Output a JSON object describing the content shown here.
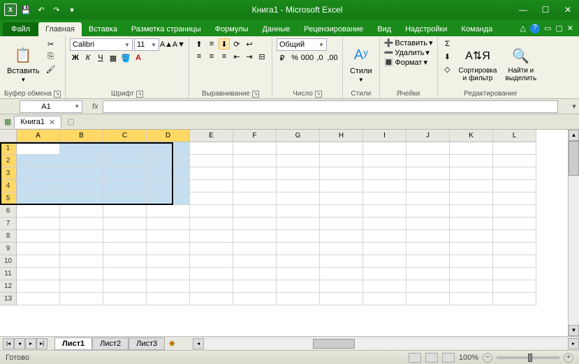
{
  "title": "Книга1 - Microsoft Excel",
  "qat": {
    "save": "💾",
    "undo": "↶",
    "redo": "↷"
  },
  "tabs": {
    "file": "Файл",
    "items": [
      "Главная",
      "Вставка",
      "Разметка страницы",
      "Формулы",
      "Данные",
      "Рецензирование",
      "Вид",
      "Надстройки",
      "Команда"
    ],
    "active": 0
  },
  "ribbon": {
    "clipboard": {
      "label": "Буфер обмена",
      "paste": "Вставить"
    },
    "font": {
      "label": "Шрифт",
      "name": "Calibri",
      "size": "11"
    },
    "align": {
      "label": "Выравнивание"
    },
    "number": {
      "label": "Число",
      "format": "Общий"
    },
    "styles": {
      "label": "Стили",
      "btn": "Стили"
    },
    "cells": {
      "label": "Ячейки",
      "insert": "Вставить",
      "delete": "Удалить",
      "format": "Формат"
    },
    "editing": {
      "label": "Редактирование",
      "sort": "Сортировка\nи фильтр",
      "find": "Найти и\nвыделить"
    }
  },
  "namebox": "A1",
  "workbook_tab": "Книга1",
  "columns": [
    "A",
    "B",
    "C",
    "D",
    "E",
    "F",
    "G",
    "H",
    "I",
    "J",
    "K",
    "L"
  ],
  "rows": [
    "1",
    "2",
    "3",
    "4",
    "5",
    "6",
    "7",
    "8",
    "9",
    "10",
    "11",
    "12",
    "13"
  ],
  "selection": {
    "rows": [
      0,
      1,
      2,
      3,
      4
    ],
    "cols": [
      0,
      1,
      2,
      3
    ],
    "active_row": 0,
    "active_col": 0
  },
  "sheets": {
    "items": [
      "Лист1",
      "Лист2",
      "Лист3"
    ],
    "active": 0
  },
  "status": {
    "ready": "Готово",
    "zoom": "100%"
  },
  "chart_data": null
}
